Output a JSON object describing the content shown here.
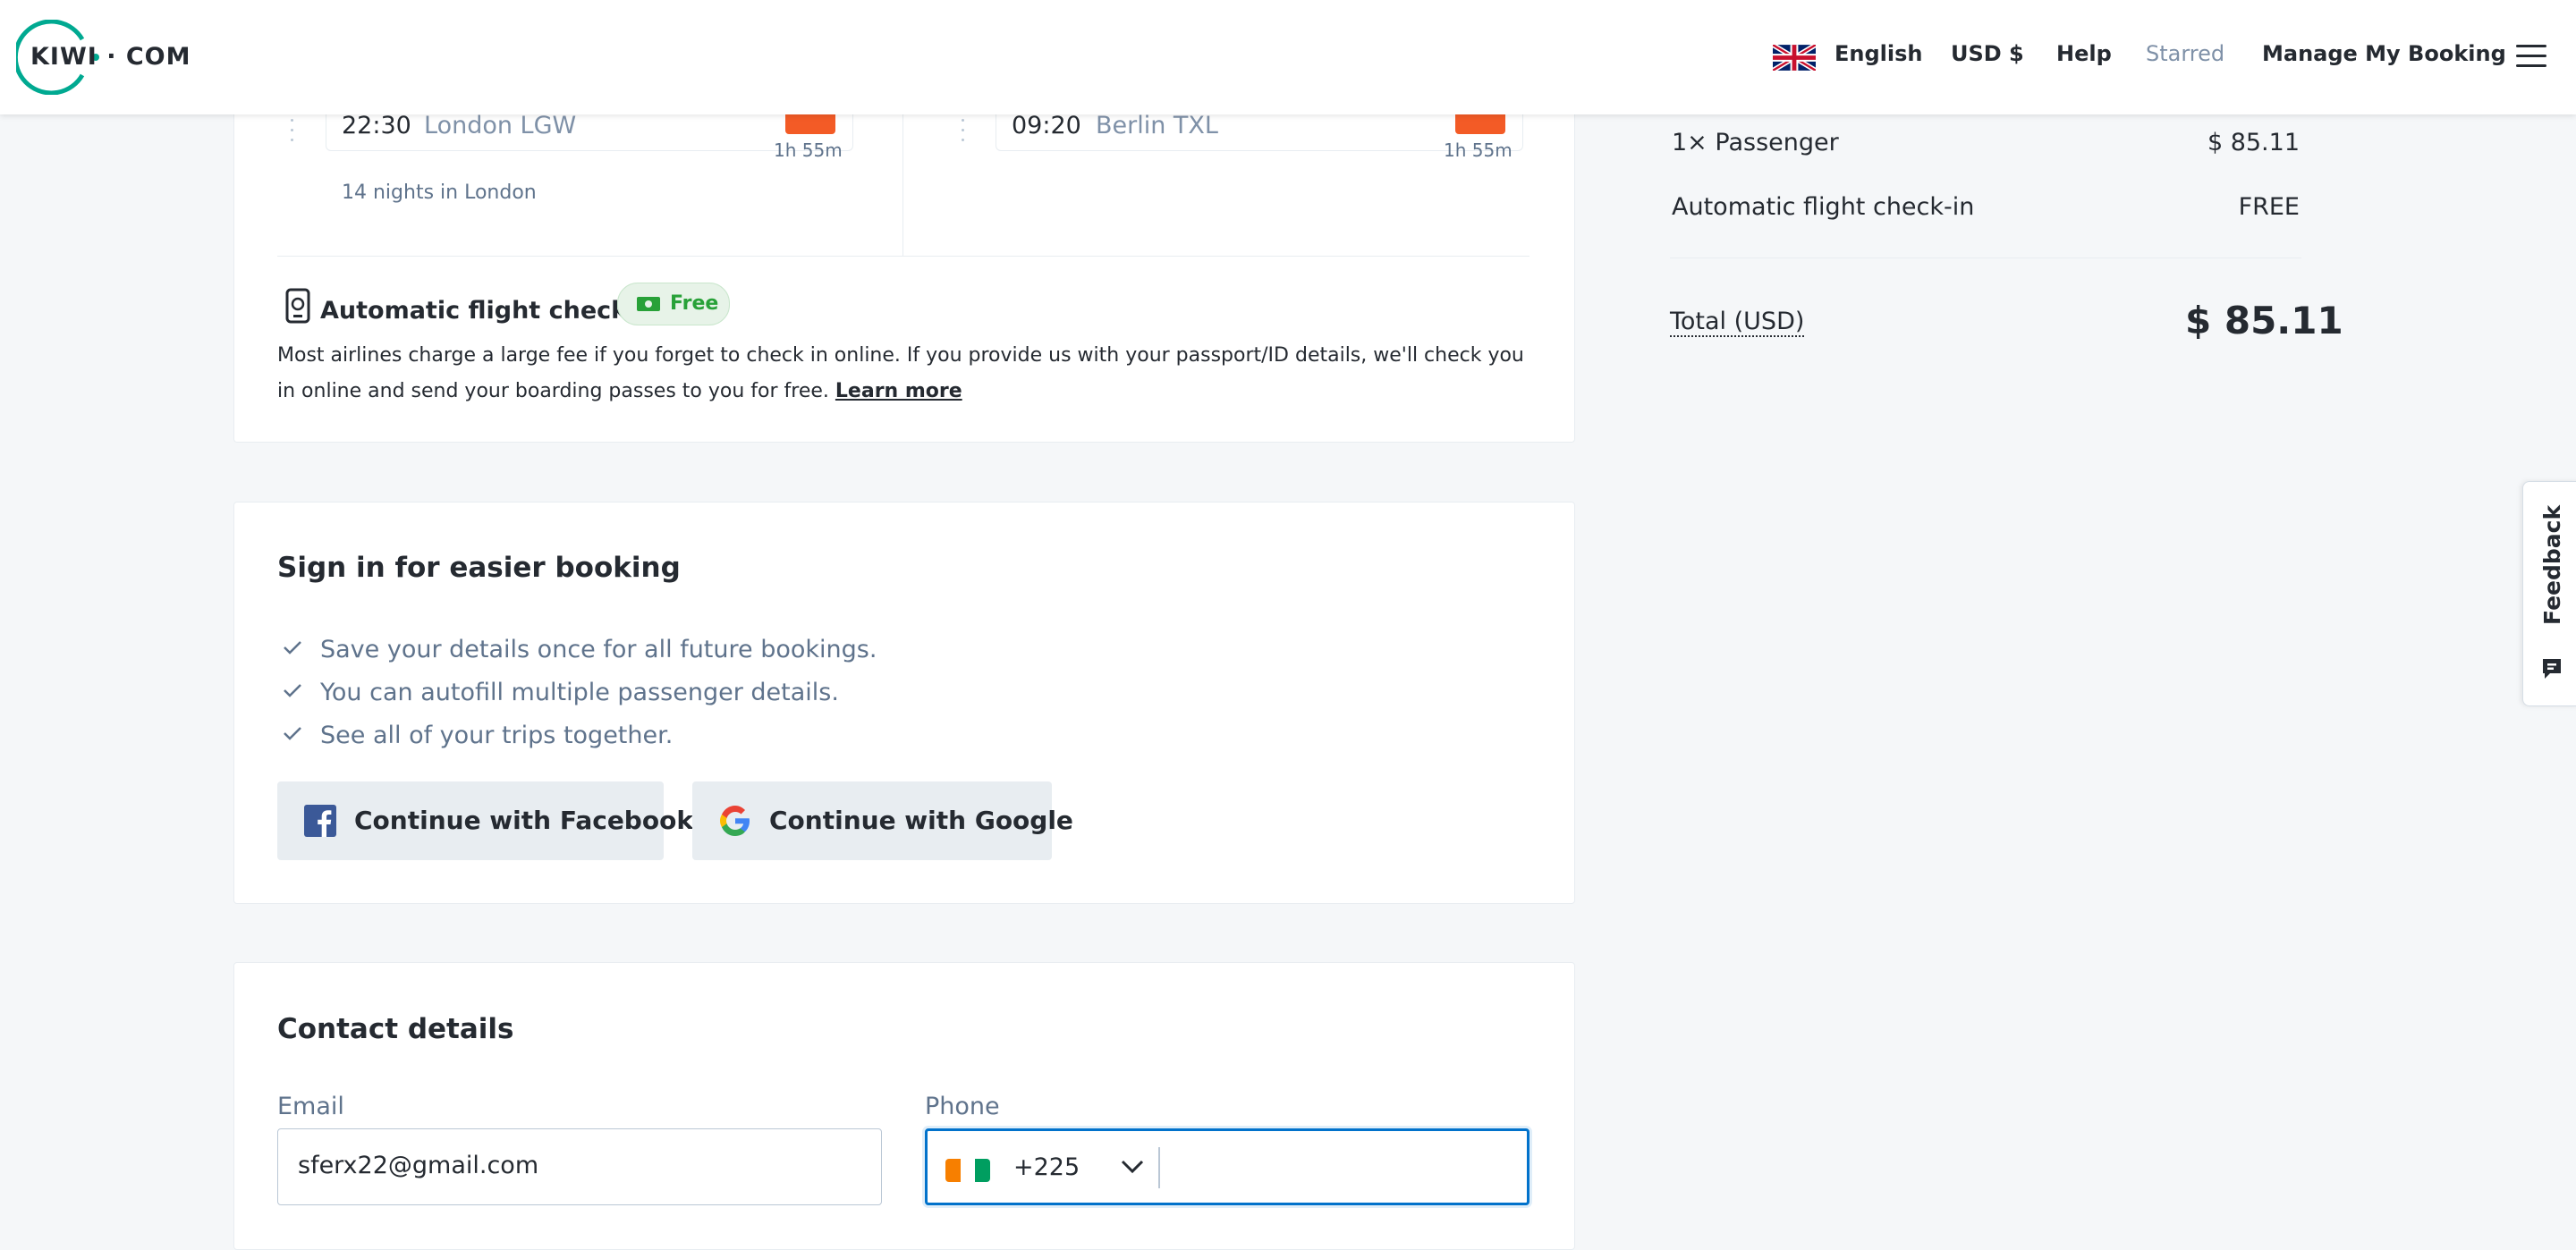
{
  "header": {
    "logo_text": "KIWI · COM",
    "language": "English",
    "currency": "USD $",
    "help": "Help",
    "starred": "Starred",
    "manage_booking": "Manage My Booking"
  },
  "itinerary": {
    "outbound": {
      "time": "22:30",
      "place": "London LGW",
      "duration": "1h 55m"
    },
    "return": {
      "time": "09:20",
      "place": "Berlin TXL",
      "duration": "1h 55m"
    },
    "nights": "14 nights in London",
    "checkin": {
      "title": "Automatic flight check-in",
      "badge": "Free",
      "description": "Most airlines charge a large fee if you forget to check in online. If you provide us with your passport/ID details, we'll check you in online and send your boarding passes to you for free.",
      "learn_more": "Learn more"
    }
  },
  "signin": {
    "title": "Sign in for easier booking",
    "benefits": [
      "Save your details once for all future bookings.",
      "You can autofill multiple passenger details.",
      "See all of your trips together."
    ],
    "facebook_button": "Continue with Facebook",
    "google_button": "Continue with Google"
  },
  "contact": {
    "title": "Contact details",
    "email_label": "Email",
    "email_value": "sferx22@gmail.com",
    "phone_label": "Phone",
    "country_code": "+225",
    "phone_value": ""
  },
  "summary": {
    "passenger_label": "1× Passenger",
    "passenger_price": "$ 85.11",
    "checkin_label": "Automatic flight check-in",
    "checkin_price": "FREE",
    "total_label": "Total (USD)",
    "total_value": "$ 85.11"
  },
  "feedback": {
    "label": "Feedback"
  },
  "colors": {
    "brand": "#00a991",
    "accent_orange": "#f35b26",
    "focus_blue": "#0172cb",
    "free_green": "#28a138"
  }
}
